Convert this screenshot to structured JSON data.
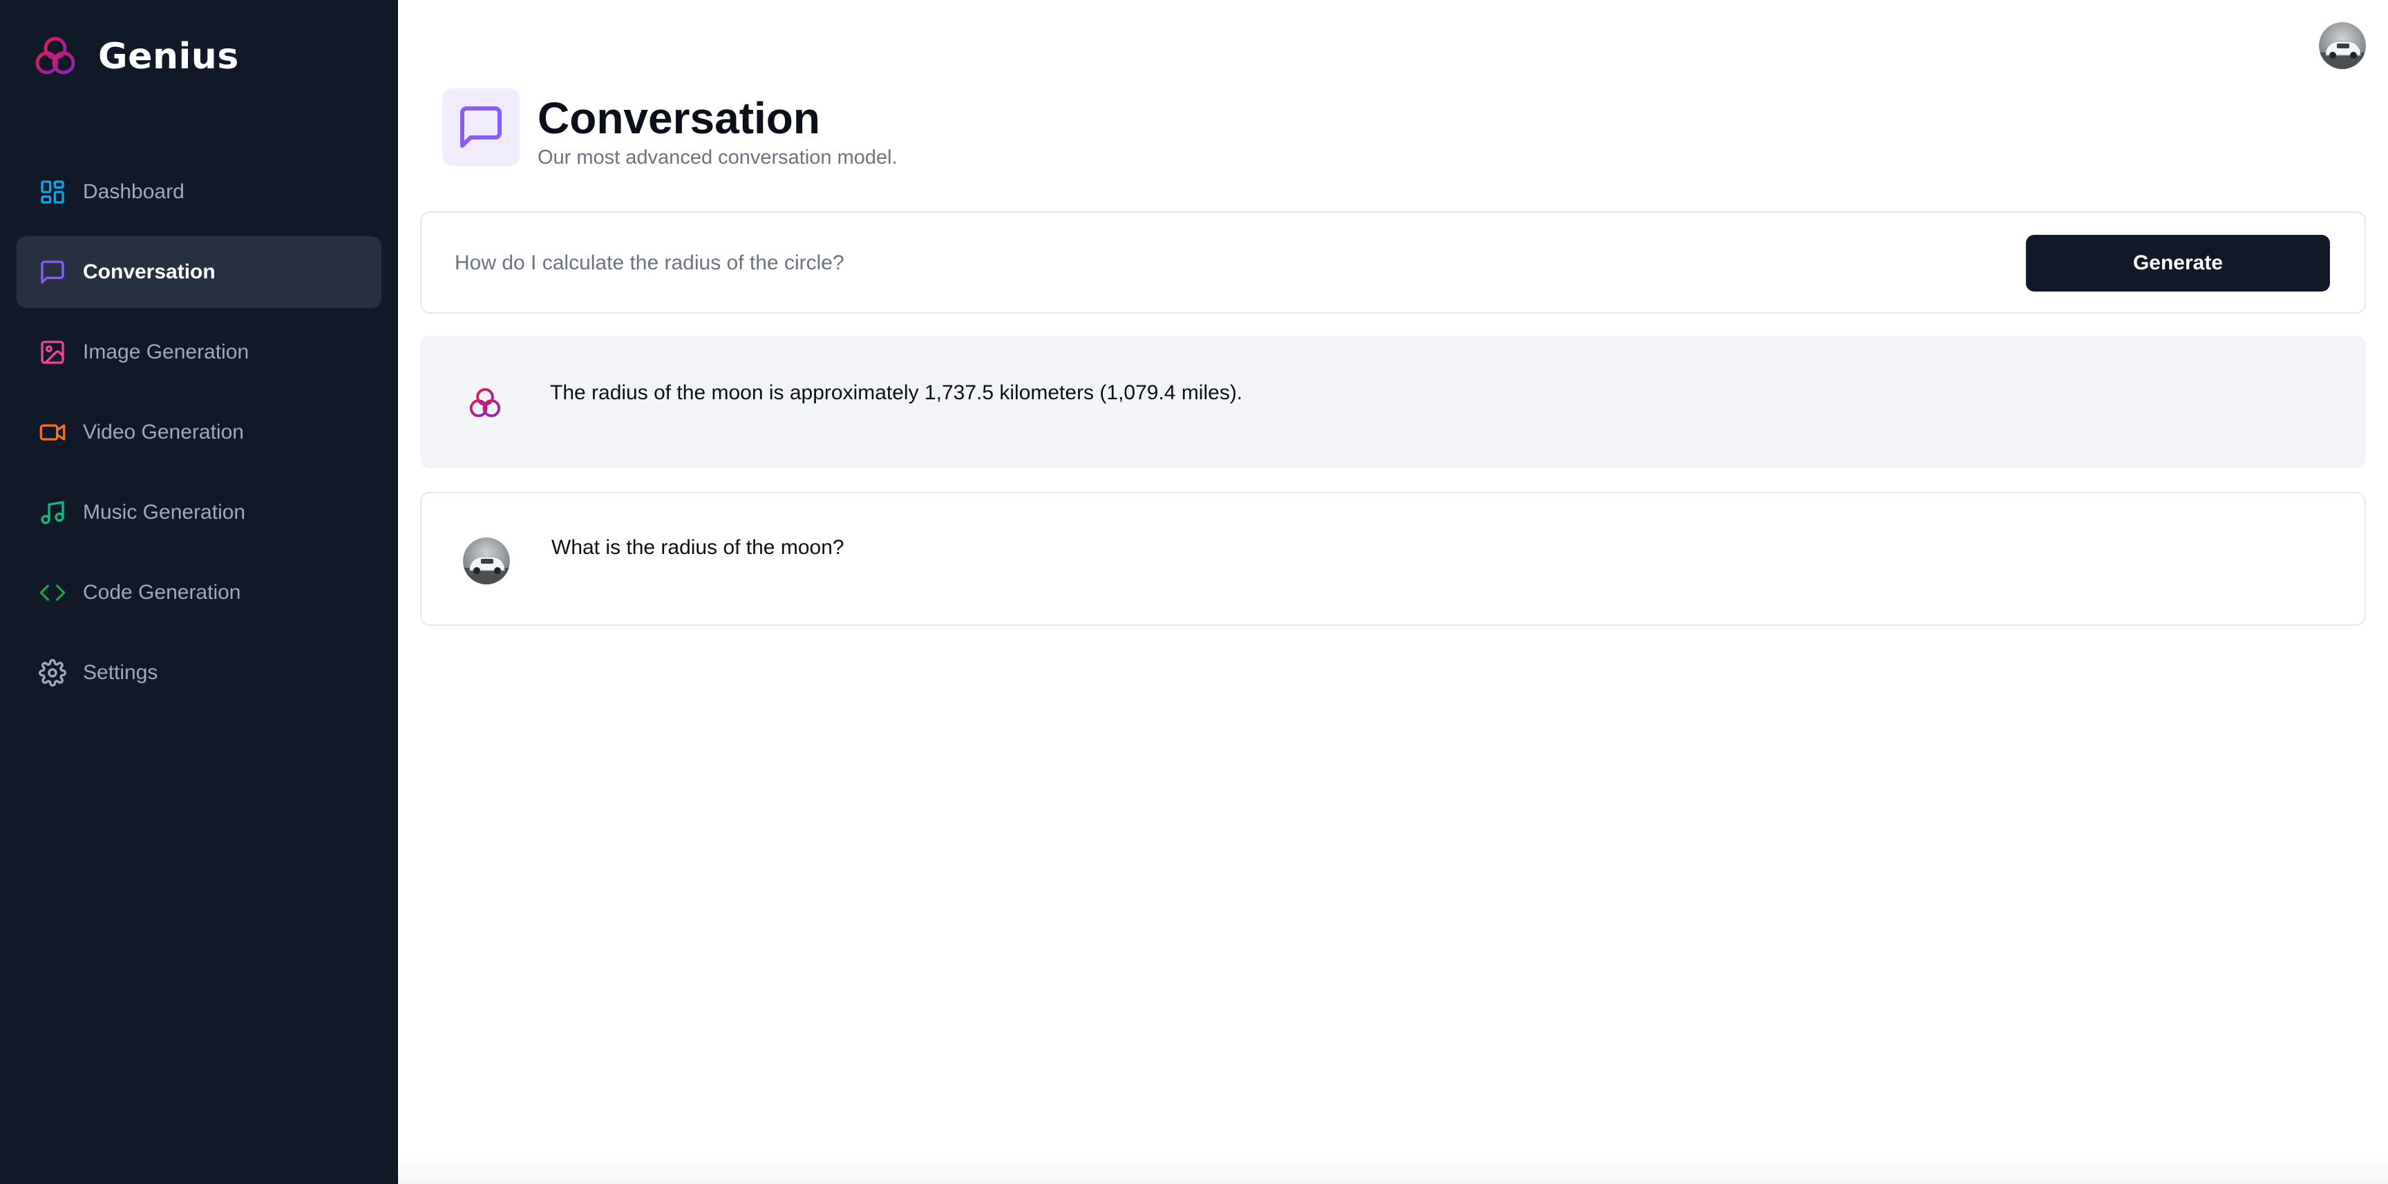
{
  "app": {
    "name": "Genius",
    "logo_icon": "genius-logo-icon",
    "brand_color": "#db2777"
  },
  "sidebar": {
    "background": "#111827",
    "items": [
      {
        "label": "Dashboard",
        "icon": "dashboard-icon",
        "color": "#0ea5e9",
        "active": false
      },
      {
        "label": "Conversation",
        "icon": "message-square-icon",
        "color": "#8b5cf6",
        "active": true
      },
      {
        "label": "Image Generation",
        "icon": "image-icon",
        "color": "#ec4899",
        "active": false
      },
      {
        "label": "Video Generation",
        "icon": "video-icon",
        "color": "#f97316",
        "active": false
      },
      {
        "label": "Music Generation",
        "icon": "music-icon",
        "color": "#10b981",
        "active": false
      },
      {
        "label": "Code Generation",
        "icon": "code-icon",
        "color": "#16a34a",
        "active": false
      },
      {
        "label": "Settings",
        "icon": "settings-icon",
        "color": "#a3a9b6",
        "active": false
      }
    ]
  },
  "header": {
    "title": "Conversation",
    "subtitle": "Our most advanced conversation model.",
    "icon": "message-square-icon",
    "icon_color": "#8b5cf6",
    "icon_bg": "#f0ebfd"
  },
  "prompt": {
    "value": "",
    "placeholder": "How do I calculate the radius of the circle?",
    "button_label": "Generate"
  },
  "messages": [
    {
      "role": "bot",
      "avatar": "genius-logo-icon",
      "text": "The radius of the moon is approximately 1,737.5 kilometers (1,079.4 miles)."
    },
    {
      "role": "user",
      "avatar": "user-avatar",
      "text": "What is the radius of the moon?"
    }
  ],
  "top_bar": {
    "avatar": "user-avatar"
  }
}
